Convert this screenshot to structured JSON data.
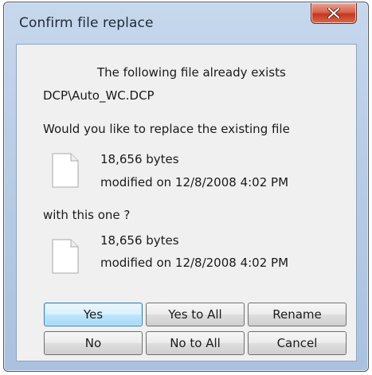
{
  "window": {
    "title": "Confirm file replace"
  },
  "message": {
    "exists_line": "The following file already exists",
    "path": "DCP\\Auto_WC.DCP",
    "question": "Would you like to replace the existing file",
    "with_label": "with this one ?"
  },
  "existing_file": {
    "size": "18,656 bytes",
    "modified": "modified on 12/8/2008 4:02 PM",
    "icon": "file-icon"
  },
  "new_file": {
    "size": "18,656 bytes",
    "modified": "modified on 12/8/2008 4:02 PM",
    "icon": "file-icon"
  },
  "buttons": {
    "yes": "Yes",
    "yes_to_all": "Yes to All",
    "rename": "Rename",
    "no": "No",
    "no_to_all": "No to All",
    "cancel": "Cancel"
  },
  "colors": {
    "close_button": "#c4371f",
    "default_button_border": "#3c7fb1"
  }
}
